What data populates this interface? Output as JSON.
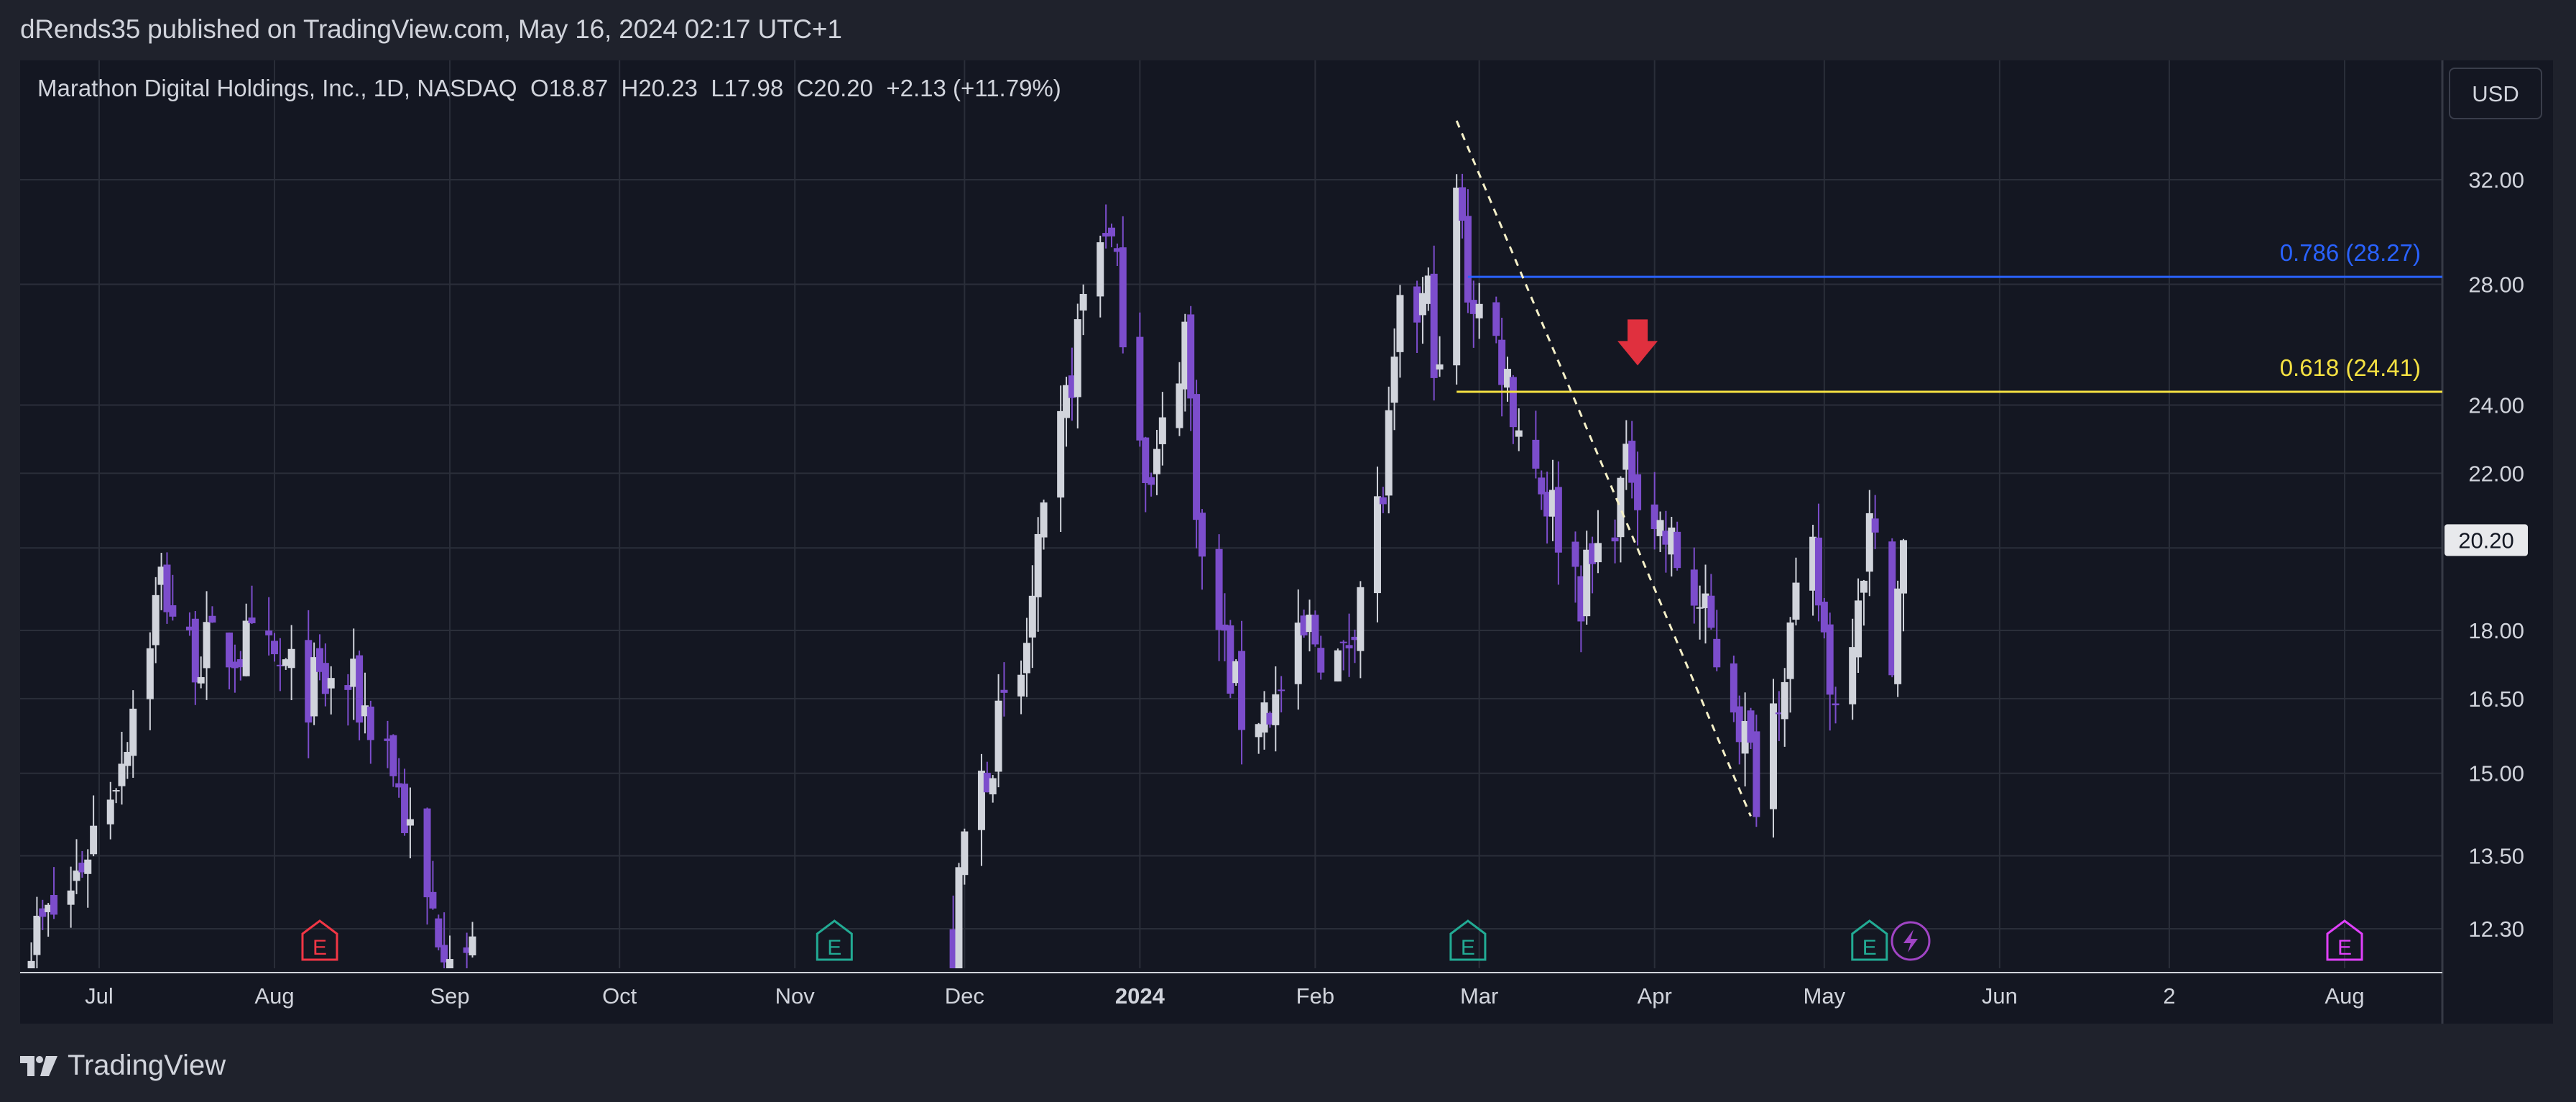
{
  "header": {
    "publish_info": "dRends35 published on TradingView.com, May 16, 2024 02:17 UTC+1"
  },
  "legend": {
    "symbol": "Marathon Digital Holdings, Inc., 1D, NASDAQ",
    "open": "O18.87",
    "high": "H20.23",
    "low": "L17.98",
    "close": "C20.20",
    "change": "+2.13 (+11.79%)"
  },
  "currency_label": "USD",
  "footer": {
    "brand": "TradingView"
  },
  "colors": {
    "background": "#141722",
    "grid": "#2a2e39",
    "up_candle": "#d1d4dc",
    "down_candle": "#7c4dcc",
    "fib_0786": "#2962ff",
    "fib_0618": "#f5e142",
    "arrow": "#e0303e",
    "earnings_past_red": "#f23645",
    "earnings_past_teal": "#22ab94",
    "earnings_future": "#e040fb"
  },
  "chart_data": {
    "type": "candlestick",
    "title": "Marathon Digital Holdings, Inc., 1D, NASDAQ",
    "y_scale": "log",
    "ylim": [
      11.8,
      37.5
    ],
    "y_ticks": [
      12.3,
      13.5,
      15.0,
      16.5,
      18.0,
      22.0,
      24.0,
      28.0,
      32.0
    ],
    "y_tick_labels": [
      "12.30",
      "13.50",
      "15.00",
      "16.50",
      "18.00",
      "22.00",
      "24.00",
      "28.00",
      "32.00"
    ],
    "last_price": "20.20",
    "x_range": [
      "2023-06-15",
      "2024-08-30"
    ],
    "x_ticks": [
      {
        "date": "2023-07-01",
        "label": "Jul"
      },
      {
        "date": "2023-08-01",
        "label": "Aug"
      },
      {
        "date": "2023-09-01",
        "label": "Sep"
      },
      {
        "date": "2023-10-01",
        "label": "Oct"
      },
      {
        "date": "2023-11-01",
        "label": "Nov"
      },
      {
        "date": "2023-12-01",
        "label": "Dec"
      },
      {
        "date": "2024-01-01",
        "label": "2024"
      },
      {
        "date": "2024-02-01",
        "label": "Feb"
      },
      {
        "date": "2024-03-01",
        "label": "Mar"
      },
      {
        "date": "2024-04-01",
        "label": "Apr"
      },
      {
        "date": "2024-05-01",
        "label": "May"
      },
      {
        "date": "2024-06-01",
        "label": "Jun"
      },
      {
        "date": "2024-07-01",
        "label": "2"
      },
      {
        "date": "2024-08-01",
        "label": "Aug"
      }
    ],
    "anchors": [
      {
        "date": "2023-06-16",
        "price": 11.8
      },
      {
        "date": "2023-06-26",
        "price": 12.9
      },
      {
        "date": "2023-07-05",
        "price": 15.4
      },
      {
        "date": "2023-07-12",
        "price": 19.2
      },
      {
        "date": "2023-07-17",
        "price": 17.5
      },
      {
        "date": "2023-07-27",
        "price": 17.6
      },
      {
        "date": "2023-08-07",
        "price": 16.7
      },
      {
        "date": "2023-08-14",
        "price": 16.8
      },
      {
        "date": "2023-08-21",
        "price": 15.6
      },
      {
        "date": "2023-08-28",
        "price": 12.6
      },
      {
        "date": "2023-09-06",
        "price": 11.8
      },
      {
        "date": "2023-11-29",
        "price": 11.9
      },
      {
        "date": "2023-12-01",
        "price": 13.8
      },
      {
        "date": "2023-12-06",
        "price": 15.6
      },
      {
        "date": "2023-12-11",
        "price": 16.9
      },
      {
        "date": "2023-12-14",
        "price": 19.5
      },
      {
        "date": "2023-12-19",
        "price": 24.0
      },
      {
        "date": "2023-12-22",
        "price": 27.5
      },
      {
        "date": "2023-12-26",
        "price": 30.5
      },
      {
        "date": "2023-12-29",
        "price": 27.0
      },
      {
        "date": "2024-01-03",
        "price": 21.5
      },
      {
        "date": "2024-01-09",
        "price": 26.5
      },
      {
        "date": "2024-01-12",
        "price": 19.5
      },
      {
        "date": "2024-01-19",
        "price": 16.2
      },
      {
        "date": "2024-01-25",
        "price": 16.4
      },
      {
        "date": "2024-01-31",
        "price": 18.0
      },
      {
        "date": "2024-02-06",
        "price": 17.2
      },
      {
        "date": "2024-02-08",
        "price": 18.6
      },
      {
        "date": "2024-02-13",
        "price": 21.5
      },
      {
        "date": "2024-02-16",
        "price": 26.5
      },
      {
        "date": "2024-02-21",
        "price": 27.5
      },
      {
        "date": "2024-02-23",
        "price": 24.5
      },
      {
        "date": "2024-02-26",
        "price": 31.5
      },
      {
        "date": "2024-02-28",
        "price": 28.0
      },
      {
        "date": "2024-03-05",
        "price": 25.5
      },
      {
        "date": "2024-03-08",
        "price": 23.5
      },
      {
        "date": "2024-03-14",
        "price": 21.0
      },
      {
        "date": "2024-03-19",
        "price": 19.0
      },
      {
        "date": "2024-03-22",
        "price": 19.8
      },
      {
        "date": "2024-03-26",
        "price": 21.5
      },
      {
        "date": "2024-03-28",
        "price": 22.3
      },
      {
        "date": "2024-04-02",
        "price": 20.5
      },
      {
        "date": "2024-04-08",
        "price": 18.8
      },
      {
        "date": "2024-04-15",
        "price": 16.6
      },
      {
        "date": "2024-04-19",
        "price": 14.8
      },
      {
        "date": "2024-04-24",
        "price": 17.5
      },
      {
        "date": "2024-04-29",
        "price": 19.6
      },
      {
        "date": "2024-05-03",
        "price": 16.3
      },
      {
        "date": "2024-05-07",
        "price": 19.2
      },
      {
        "date": "2024-05-09",
        "price": 20.5
      },
      {
        "date": "2024-05-13",
        "price": 17.8
      },
      {
        "date": "2024-05-15",
        "price": 20.2
      }
    ],
    "trendline": {
      "from": {
        "date": "2024-02-26",
        "price": 34.5
      },
      "to": {
        "date": "2024-04-18",
        "price": 14.2
      },
      "style": "dashed"
    },
    "fib_levels": [
      {
        "ratio": "0.786",
        "value": 28.27,
        "label": "0.786 (28.27)",
        "from": "2024-02-28",
        "color": "#2962ff"
      },
      {
        "ratio": "0.618",
        "value": 24.41,
        "label": "0.618 (24.41)",
        "from": "2024-02-26",
        "color": "#f5e142"
      }
    ],
    "arrow_marker": {
      "date": "2024-03-29",
      "direction": "down",
      "price": 25.2
    },
    "earnings_markers": [
      {
        "date": "2023-08-09",
        "label": "E",
        "color": "#f23645"
      },
      {
        "date": "2023-11-08",
        "label": "E",
        "color": "#22ab94"
      },
      {
        "date": "2024-02-28",
        "label": "E",
        "color": "#22ab94"
      },
      {
        "date": "2024-05-09",
        "label": "E",
        "color": "#22ab94"
      },
      {
        "date": "2024-08-01",
        "label": "E",
        "color": "#e040fb"
      }
    ],
    "dividend_marker": {
      "date": "2024-05-15",
      "icon": "lightning-icon",
      "color": "#a044c4"
    }
  }
}
